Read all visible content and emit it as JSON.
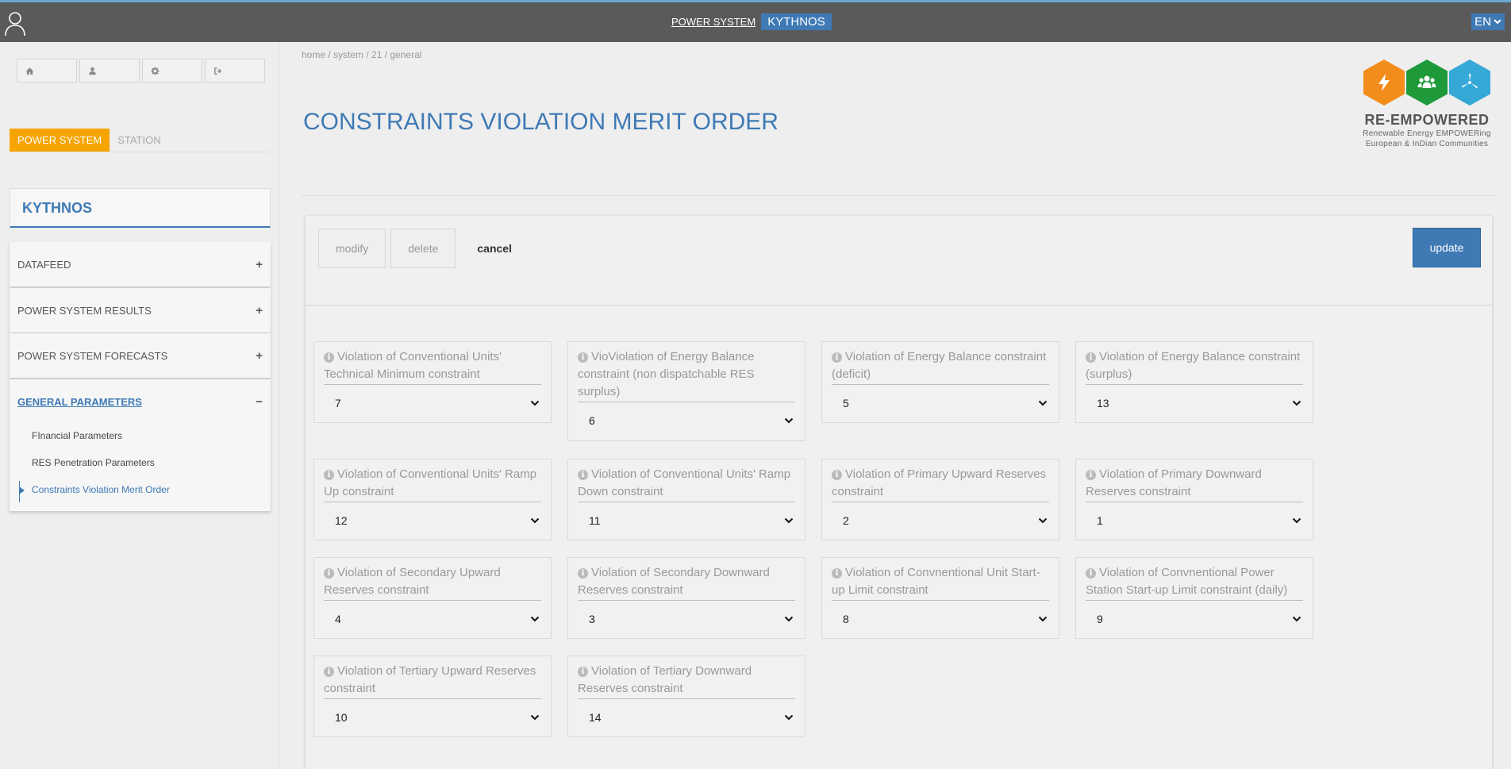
{
  "topbar": {
    "system_label": "POWER SYSTEM",
    "station_label": "KYTHNOS",
    "language": "EN"
  },
  "sidebar": {
    "quick_buttons": [
      {
        "icon": "home-icon"
      },
      {
        "icon": "user-icon"
      },
      {
        "icon": "gear-icon"
      },
      {
        "icon": "sign-out-icon"
      }
    ],
    "scope_tabs": [
      "POWER SYSTEM",
      "STATION"
    ],
    "station_name": "KYTHNOS",
    "sections": [
      {
        "title": "DATAFEED",
        "sign": "+"
      },
      {
        "title": "POWER SYSTEM RESULTS",
        "sign": "+"
      },
      {
        "title": "POWER SYSTEM FORECASTS",
        "sign": "+"
      },
      {
        "title": "GENERAL PARAMETERS",
        "sign": "−",
        "items": [
          "FInancial Parameters",
          "RES Penetration Parameters",
          "Constraints Violation Merit Order"
        ]
      }
    ]
  },
  "breadcrumb": "home / system / 21 / general",
  "page_title": "CONSTRAINTS VIOLATION MERIT ORDER",
  "logo": {
    "name": "RE-EMPOWERED",
    "tagline_1": "Renewable Energy EMPOWERing",
    "tagline_2": "European & InDian Communities",
    "colors": [
      "#f28c1b",
      "#1e9a3a",
      "#35a8d8"
    ]
  },
  "actions": {
    "modify": "modify",
    "delete": "delete",
    "cancel": "cancel",
    "update": "update"
  },
  "constraints": [
    {
      "label": "Violation of Conventional Units' Technical Minimum constraint",
      "value": "7"
    },
    {
      "label": "VioViolation of Energy Balance constraint (non dispatchable RES surplus)",
      "value": "6"
    },
    {
      "label": "Violation of Energy Balance constraint (deficit)",
      "value": "5"
    },
    {
      "label": "Violation of Energy Balance constraint (surplus)",
      "value": "13"
    },
    {
      "label": "Violation of Conventional Units' Ramp Up constraint",
      "value": "12"
    },
    {
      "label": "Violation of Conventional Units' Ramp Down constraint",
      "value": "11"
    },
    {
      "label": "Violation of Primary Upward Reserves constraint",
      "value": "2"
    },
    {
      "label": "Violation of Primary Downward Reserves constraint",
      "value": "1"
    },
    {
      "label": "Violation of Secondary Upward Reserves constraint",
      "value": "4"
    },
    {
      "label": "Violation of Secondary Downward Reserves constraint",
      "value": "3"
    },
    {
      "label": "Violation of Convnentional Unit Start-up Limit constraint",
      "value": "8"
    },
    {
      "label": "Violation of Convnentional Power Station Start-up Limit constraint (daily)",
      "value": "9"
    },
    {
      "label": "Violation of Tertiary Upward Reserves constraint",
      "value": "10"
    },
    {
      "label": "Violation of Tertiary Downward Reserves constraint",
      "value": "14"
    }
  ]
}
